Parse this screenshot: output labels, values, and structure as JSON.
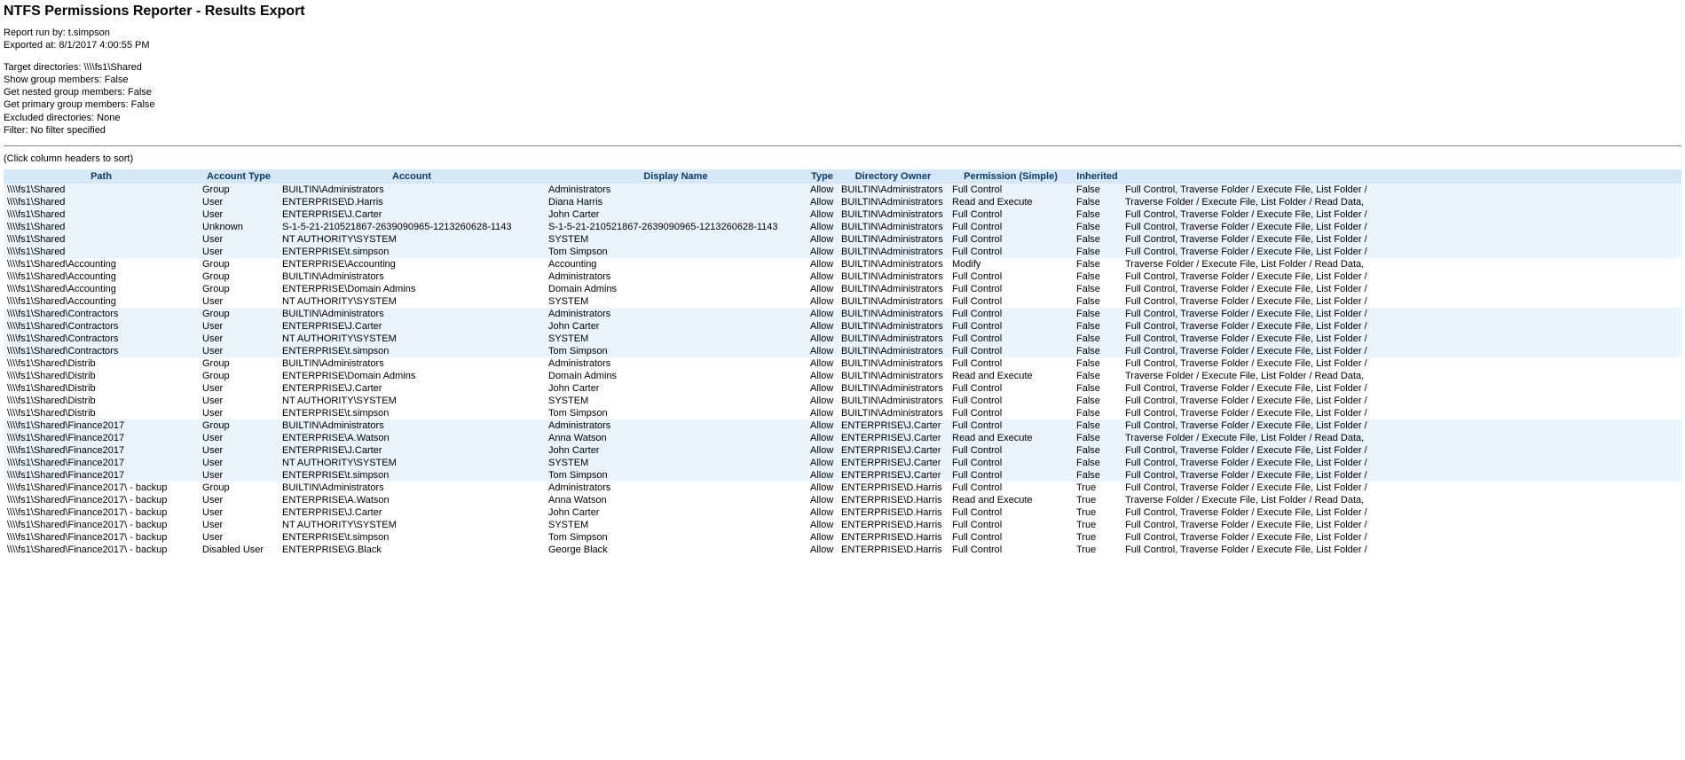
{
  "title": "NTFS Permissions Reporter - Results Export",
  "meta1": [
    "Report run by: t.simpson",
    "Exported at: 8/1/2017 4:00:55 PM"
  ],
  "meta2": [
    "Target directories: \\\\\\\\fs1\\Shared",
    "Show group members: False",
    "Get nested group members: False",
    "Get primary group members: False",
    "Excluded directories: None",
    "Filter: No filter specified"
  ],
  "sort_hint": "(Click column headers to sort)",
  "columns": [
    "Path",
    "Account Type",
    "Account",
    "Display Name",
    "Type",
    "Directory Owner",
    "Permission (Simple)",
    "Inherited",
    ""
  ],
  "full_long": "Full Control, Traverse Folder / Execute File, List Folder /",
  "trav_long": "Traverse Folder / Execute File, List Folder / Read Data,",
  "groups": [
    {
      "banded": true,
      "rows": [
        {
          "path": "\\\\\\\\fs1\\Shared",
          "acctype": "Group",
          "account": "BUILTIN\\Administrators",
          "display": "Administrators",
          "type": "Allow",
          "owner": "BUILTIN\\Administrators",
          "perm": "Full Control",
          "inher": "False",
          "full": "full"
        },
        {
          "path": "\\\\\\\\fs1\\Shared",
          "acctype": "User",
          "account": "ENTERPRISE\\D.Harris",
          "display": "Diana Harris",
          "type": "Allow",
          "owner": "BUILTIN\\Administrators",
          "perm": "Read and Execute",
          "inher": "False",
          "full": "trav"
        },
        {
          "path": "\\\\\\\\fs1\\Shared",
          "acctype": "User",
          "account": "ENTERPRISE\\J.Carter",
          "display": "John Carter",
          "type": "Allow",
          "owner": "BUILTIN\\Administrators",
          "perm": "Full Control",
          "inher": "False",
          "full": "full"
        },
        {
          "path": "\\\\\\\\fs1\\Shared",
          "acctype": "Unknown",
          "account": "S-1-5-21-210521867-2639090965-1213260628-1143",
          "display": "S-1-5-21-210521867-2639090965-1213260628-1143",
          "type": "Allow",
          "owner": "BUILTIN\\Administrators",
          "perm": "Full Control",
          "inher": "False",
          "full": "full"
        },
        {
          "path": "\\\\\\\\fs1\\Shared",
          "acctype": "User",
          "account": "NT AUTHORITY\\SYSTEM",
          "display": "SYSTEM",
          "type": "Allow",
          "owner": "BUILTIN\\Administrators",
          "perm": "Full Control",
          "inher": "False",
          "full": "full"
        },
        {
          "path": "\\\\\\\\fs1\\Shared",
          "acctype": "User",
          "account": "ENTERPRISE\\t.simpson",
          "display": "Tom Simpson",
          "type": "Allow",
          "owner": "BUILTIN\\Administrators",
          "perm": "Full Control",
          "inher": "False",
          "full": "full"
        }
      ]
    },
    {
      "banded": false,
      "rows": [
        {
          "path": "\\\\\\\\fs1\\Shared\\Accounting",
          "acctype": "Group",
          "account": "ENTERPRISE\\Accounting",
          "display": "Accounting",
          "type": "Allow",
          "owner": "BUILTIN\\Administrators",
          "perm": "Modify",
          "inher": "False",
          "full": "trav"
        },
        {
          "path": "\\\\\\\\fs1\\Shared\\Accounting",
          "acctype": "Group",
          "account": "BUILTIN\\Administrators",
          "display": "Administrators",
          "type": "Allow",
          "owner": "BUILTIN\\Administrators",
          "perm": "Full Control",
          "inher": "False",
          "full": "full"
        },
        {
          "path": "\\\\\\\\fs1\\Shared\\Accounting",
          "acctype": "Group",
          "account": "ENTERPRISE\\Domain Admins",
          "display": "Domain Admins",
          "type": "Allow",
          "owner": "BUILTIN\\Administrators",
          "perm": "Full Control",
          "inher": "False",
          "full": "full"
        },
        {
          "path": "\\\\\\\\fs1\\Shared\\Accounting",
          "acctype": "User",
          "account": "NT AUTHORITY\\SYSTEM",
          "display": "SYSTEM",
          "type": "Allow",
          "owner": "BUILTIN\\Administrators",
          "perm": "Full Control",
          "inher": "False",
          "full": "full"
        }
      ]
    },
    {
      "banded": true,
      "rows": [
        {
          "path": "\\\\\\\\fs1\\Shared\\Contractors",
          "acctype": "Group",
          "account": "BUILTIN\\Administrators",
          "display": "Administrators",
          "type": "Allow",
          "owner": "BUILTIN\\Administrators",
          "perm": "Full Control",
          "inher": "False",
          "full": "full"
        },
        {
          "path": "\\\\\\\\fs1\\Shared\\Contractors",
          "acctype": "User",
          "account": "ENTERPRISE\\J.Carter",
          "display": "John Carter",
          "type": "Allow",
          "owner": "BUILTIN\\Administrators",
          "perm": "Full Control",
          "inher": "False",
          "full": "full"
        },
        {
          "path": "\\\\\\\\fs1\\Shared\\Contractors",
          "acctype": "User",
          "account": "NT AUTHORITY\\SYSTEM",
          "display": "SYSTEM",
          "type": "Allow",
          "owner": "BUILTIN\\Administrators",
          "perm": "Full Control",
          "inher": "False",
          "full": "full"
        },
        {
          "path": "\\\\\\\\fs1\\Shared\\Contractors",
          "acctype": "User",
          "account": "ENTERPRISE\\t.simpson",
          "display": "Tom Simpson",
          "type": "Allow",
          "owner": "BUILTIN\\Administrators",
          "perm": "Full Control",
          "inher": "False",
          "full": "full"
        }
      ]
    },
    {
      "banded": false,
      "rows": [
        {
          "path": "\\\\\\\\fs1\\Shared\\Distrib",
          "acctype": "Group",
          "account": "BUILTIN\\Administrators",
          "display": "Administrators",
          "type": "Allow",
          "owner": "BUILTIN\\Administrators",
          "perm": "Full Control",
          "inher": "False",
          "full": "full"
        },
        {
          "path": "\\\\\\\\fs1\\Shared\\Distrib",
          "acctype": "Group",
          "account": "ENTERPRISE\\Domain Admins",
          "display": "Domain Admins",
          "type": "Allow",
          "owner": "BUILTIN\\Administrators",
          "perm": "Read and Execute",
          "inher": "False",
          "full": "trav"
        },
        {
          "path": "\\\\\\\\fs1\\Shared\\Distrib",
          "acctype": "User",
          "account": "ENTERPRISE\\J.Carter",
          "display": "John Carter",
          "type": "Allow",
          "owner": "BUILTIN\\Administrators",
          "perm": "Full Control",
          "inher": "False",
          "full": "full"
        },
        {
          "path": "\\\\\\\\fs1\\Shared\\Distrib",
          "acctype": "User",
          "account": "NT AUTHORITY\\SYSTEM",
          "display": "SYSTEM",
          "type": "Allow",
          "owner": "BUILTIN\\Administrators",
          "perm": "Full Control",
          "inher": "False",
          "full": "full"
        },
        {
          "path": "\\\\\\\\fs1\\Shared\\Distrib",
          "acctype": "User",
          "account": "ENTERPRISE\\t.simpson",
          "display": "Tom Simpson",
          "type": "Allow",
          "owner": "BUILTIN\\Administrators",
          "perm": "Full Control",
          "inher": "False",
          "full": "full"
        }
      ]
    },
    {
      "banded": true,
      "rows": [
        {
          "path": "\\\\\\\\fs1\\Shared\\Finance2017",
          "acctype": "Group",
          "account": "BUILTIN\\Administrators",
          "display": "Administrators",
          "type": "Allow",
          "owner": "ENTERPRISE\\J.Carter",
          "perm": "Full Control",
          "inher": "False",
          "full": "full"
        },
        {
          "path": "\\\\\\\\fs1\\Shared\\Finance2017",
          "acctype": "User",
          "account": "ENTERPRISE\\A.Watson",
          "display": "Anna Watson",
          "type": "Allow",
          "owner": "ENTERPRISE\\J.Carter",
          "perm": "Read and Execute",
          "inher": "False",
          "full": "trav"
        },
        {
          "path": "\\\\\\\\fs1\\Shared\\Finance2017",
          "acctype": "User",
          "account": "ENTERPRISE\\J.Carter",
          "display": "John Carter",
          "type": "Allow",
          "owner": "ENTERPRISE\\J.Carter",
          "perm": "Full Control",
          "inher": "False",
          "full": "full"
        },
        {
          "path": "\\\\\\\\fs1\\Shared\\Finance2017",
          "acctype": "User",
          "account": "NT AUTHORITY\\SYSTEM",
          "display": "SYSTEM",
          "type": "Allow",
          "owner": "ENTERPRISE\\J.Carter",
          "perm": "Full Control",
          "inher": "False",
          "full": "full"
        },
        {
          "path": "\\\\\\\\fs1\\Shared\\Finance2017",
          "acctype": "User",
          "account": "ENTERPRISE\\t.simpson",
          "display": "Tom Simpson",
          "type": "Allow",
          "owner": "ENTERPRISE\\J.Carter",
          "perm": "Full Control",
          "inher": "False",
          "full": "full"
        }
      ]
    },
    {
      "banded": false,
      "rows": [
        {
          "path": "\\\\\\\\fs1\\Shared\\Finance2017\\ - backup",
          "acctype": "Group",
          "account": "BUILTIN\\Administrators",
          "display": "Administrators",
          "type": "Allow",
          "owner": "ENTERPRISE\\D.Harris",
          "perm": "Full Control",
          "inher": "True",
          "full": "full"
        },
        {
          "path": "\\\\\\\\fs1\\Shared\\Finance2017\\ - backup",
          "acctype": "User",
          "account": "ENTERPRISE\\A.Watson",
          "display": "Anna Watson",
          "type": "Allow",
          "owner": "ENTERPRISE\\D.Harris",
          "perm": "Read and Execute",
          "inher": "True",
          "full": "trav"
        },
        {
          "path": "\\\\\\\\fs1\\Shared\\Finance2017\\ - backup",
          "acctype": "User",
          "account": "ENTERPRISE\\J.Carter",
          "display": "John Carter",
          "type": "Allow",
          "owner": "ENTERPRISE\\D.Harris",
          "perm": "Full Control",
          "inher": "True",
          "full": "full"
        },
        {
          "path": "\\\\\\\\fs1\\Shared\\Finance2017\\ - backup",
          "acctype": "User",
          "account": "NT AUTHORITY\\SYSTEM",
          "display": "SYSTEM",
          "type": "Allow",
          "owner": "ENTERPRISE\\D.Harris",
          "perm": "Full Control",
          "inher": "True",
          "full": "full"
        },
        {
          "path": "\\\\\\\\fs1\\Shared\\Finance2017\\ - backup",
          "acctype": "User",
          "account": "ENTERPRISE\\t.simpson",
          "display": "Tom Simpson",
          "type": "Allow",
          "owner": "ENTERPRISE\\D.Harris",
          "perm": "Full Control",
          "inher": "True",
          "full": "full"
        },
        {
          "path": "\\\\\\\\fs1\\Shared\\Finance2017\\ - backup",
          "acctype": "Disabled User",
          "account": "ENTERPRISE\\G.Black",
          "display": "George Black",
          "type": "Allow",
          "owner": "ENTERPRISE\\D.Harris",
          "perm": "Full Control",
          "inher": "True",
          "full": "full"
        }
      ]
    }
  ]
}
